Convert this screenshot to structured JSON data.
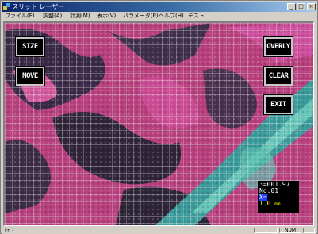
{
  "window": {
    "title": "スリット レーザー",
    "controls": {
      "minimize": "_",
      "maximize": "□",
      "close": "×"
    }
  },
  "menu": [
    "ファイル(F)",
    "調整(A)",
    "計測(M)",
    "表示(V)",
    "パラメータ(P)",
    "ヘルプ(H)",
    "テスト"
  ],
  "overlay_buttons": {
    "size": "SIZE",
    "move": "MOVE",
    "overly": "OVERLY",
    "clear": "CLEAR",
    "exit": "EXIT"
  },
  "readout": {
    "line1": "3=001.97",
    "line2": "No.01",
    "line3": "X=",
    "line4_value": "1.0",
    "line4_unit": "mm"
  },
  "status": {
    "text": "ﾚﾃﾞｨ",
    "num": "NUM"
  },
  "colors": {
    "grid": "#e8e8e8",
    "pink": "#c8408a",
    "cyan": "#50c8b8",
    "dark": "#202838"
  }
}
